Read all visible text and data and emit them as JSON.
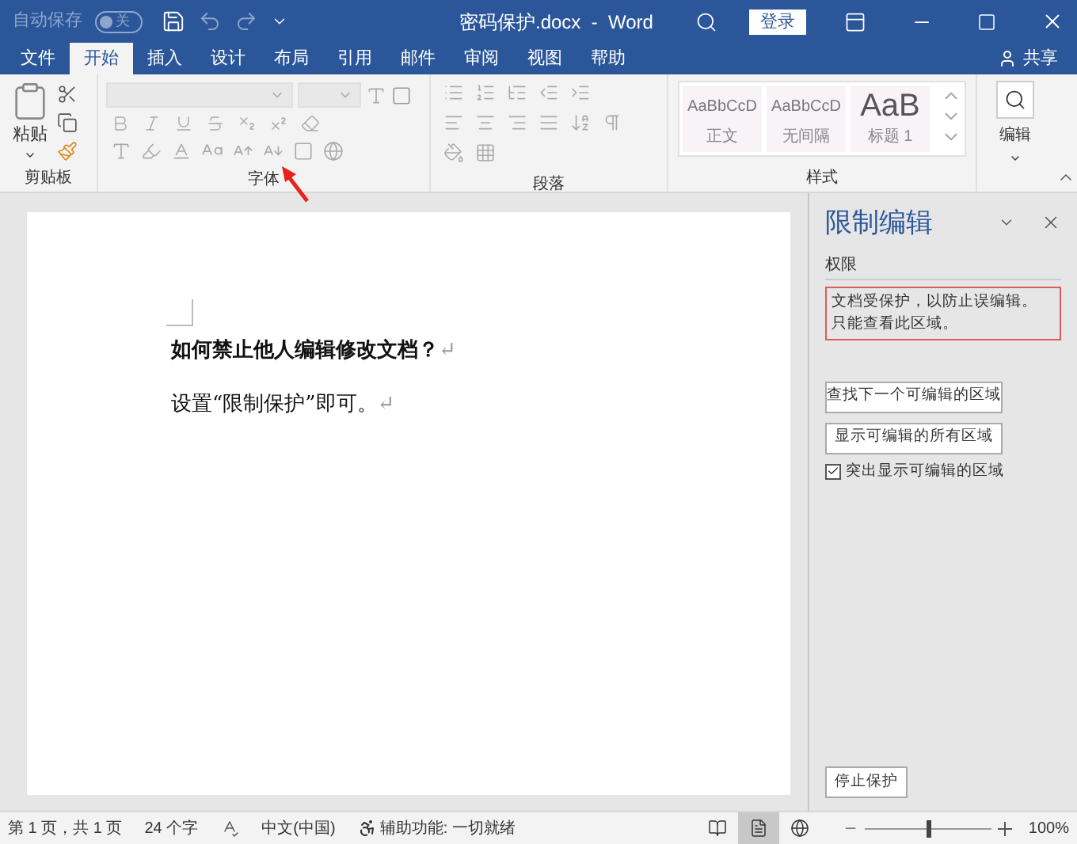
{
  "title_bar": {
    "autosave_label": "自动保存",
    "autosave_toggle": {
      "on": false,
      "label": "关"
    },
    "title": "密码保护.docx  -  Word",
    "sign_in": "登录"
  },
  "tabs": [
    {
      "label": "文件",
      "selected": false
    },
    {
      "label": "开始",
      "selected": true
    },
    {
      "label": "插入",
      "selected": false
    },
    {
      "label": "设计",
      "selected": false
    },
    {
      "label": "布局",
      "selected": false
    },
    {
      "label": "引用",
      "selected": false
    },
    {
      "label": "邮件",
      "selected": false
    },
    {
      "label": "审阅",
      "selected": false
    },
    {
      "label": "视图",
      "selected": false
    },
    {
      "label": "帮助",
      "selected": false
    }
  ],
  "share": "共享",
  "ribbon": {
    "paste": "粘贴",
    "groups": [
      "剪贴板",
      "字体",
      "段落",
      "样式"
    ],
    "styles": [
      {
        "preview": "AaBbCcD",
        "name": "正文",
        "kind": "normal"
      },
      {
        "preview": "AaBbCcD",
        "name": "无间隔",
        "kind": "normal"
      },
      {
        "preview": "AaB",
        "name": "标题 1",
        "kind": "heading"
      }
    ],
    "editing": "编辑"
  },
  "document": {
    "paragraphs": [
      {
        "text": "如何禁止他人编辑修改文档？",
        "bold": true,
        "mark": "↵"
      },
      {
        "text": "设置“限制保护”即可。",
        "bold": false,
        "mark": "↵"
      }
    ]
  },
  "pane": {
    "title": "限制编辑",
    "section": "权限",
    "message_lines": [
      "文档受保护，以防止误编辑。",
      "只能查看此区域。"
    ],
    "buttons": [
      "查找下一个可编辑的区域",
      "显示可编辑的所有区域"
    ],
    "checkbox": {
      "label": "突出显示可编辑的区域",
      "checked": true
    },
    "stop_button": "停止保护"
  },
  "status_bar": {
    "page": "第 1 页，共 1 页",
    "words": "24 个字",
    "language": "中文(中国)",
    "accessibility": "辅助功能: 一切就绪",
    "views": [
      {
        "kind": "read",
        "selected": false
      },
      {
        "kind": "print",
        "selected": true
      },
      {
        "kind": "web",
        "selected": false
      }
    ],
    "zoom_slider": {
      "level": 0.5
    },
    "zoom": "100%"
  }
}
